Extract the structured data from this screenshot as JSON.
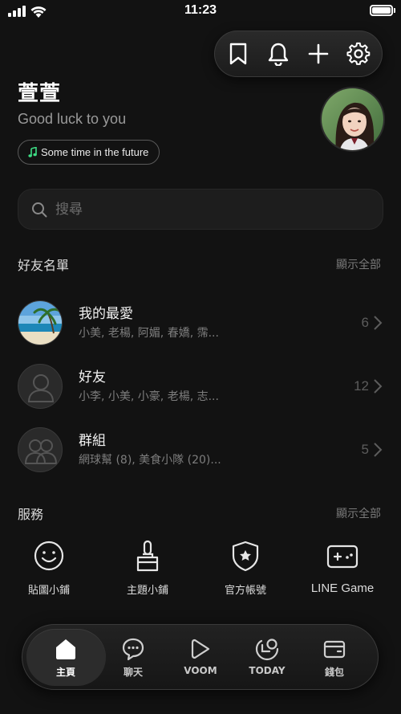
{
  "status_bar": {
    "time": "11:23"
  },
  "toolbar": {
    "icons": [
      "bookmark-icon",
      "bell-icon",
      "plus-icon",
      "gear-icon"
    ]
  },
  "profile": {
    "name": "萱萱",
    "status_message": "Good luck to you",
    "music": "Some time in the future"
  },
  "search": {
    "placeholder": "搜尋"
  },
  "friends_section": {
    "title": "好友名單",
    "show_all": "顯示全部",
    "rows": [
      {
        "title": "我的最愛",
        "subtitle": "小美, 老楊, 阿媚, 春嬌, 霈...",
        "count": "6"
      },
      {
        "title": "好友",
        "subtitle": "小李, 小美, 小豪, 老楊, 志...",
        "count": "12"
      },
      {
        "title": "群組",
        "subtitle": "網球幫 (8), 美食小隊 (20)...",
        "count": "5"
      }
    ]
  },
  "services_section": {
    "title": "服務",
    "show_all": "顯示全部",
    "items": [
      {
        "label": "貼圖小鋪",
        "icon": "smile-icon"
      },
      {
        "label": "主題小鋪",
        "icon": "brush-icon"
      },
      {
        "label": "官方帳號",
        "icon": "shield-star-icon"
      },
      {
        "label": "LINE Game",
        "icon": "gamepad-icon"
      }
    ]
  },
  "bottom_nav": {
    "items": [
      {
        "label": "主頁",
        "icon": "home-icon",
        "active": true
      },
      {
        "label": "聊天",
        "icon": "chat-icon",
        "active": false
      },
      {
        "label": "VOOM",
        "icon": "play-icon",
        "active": false
      },
      {
        "label": "TODAY",
        "icon": "today-icon",
        "active": false
      },
      {
        "label": "錢包",
        "icon": "wallet-icon",
        "active": false
      }
    ]
  },
  "colors": {
    "background": "#121212",
    "music_note": "#3ddc84",
    "text_primary": "#f2f2f2",
    "text_secondary": "#7d7d7d"
  }
}
